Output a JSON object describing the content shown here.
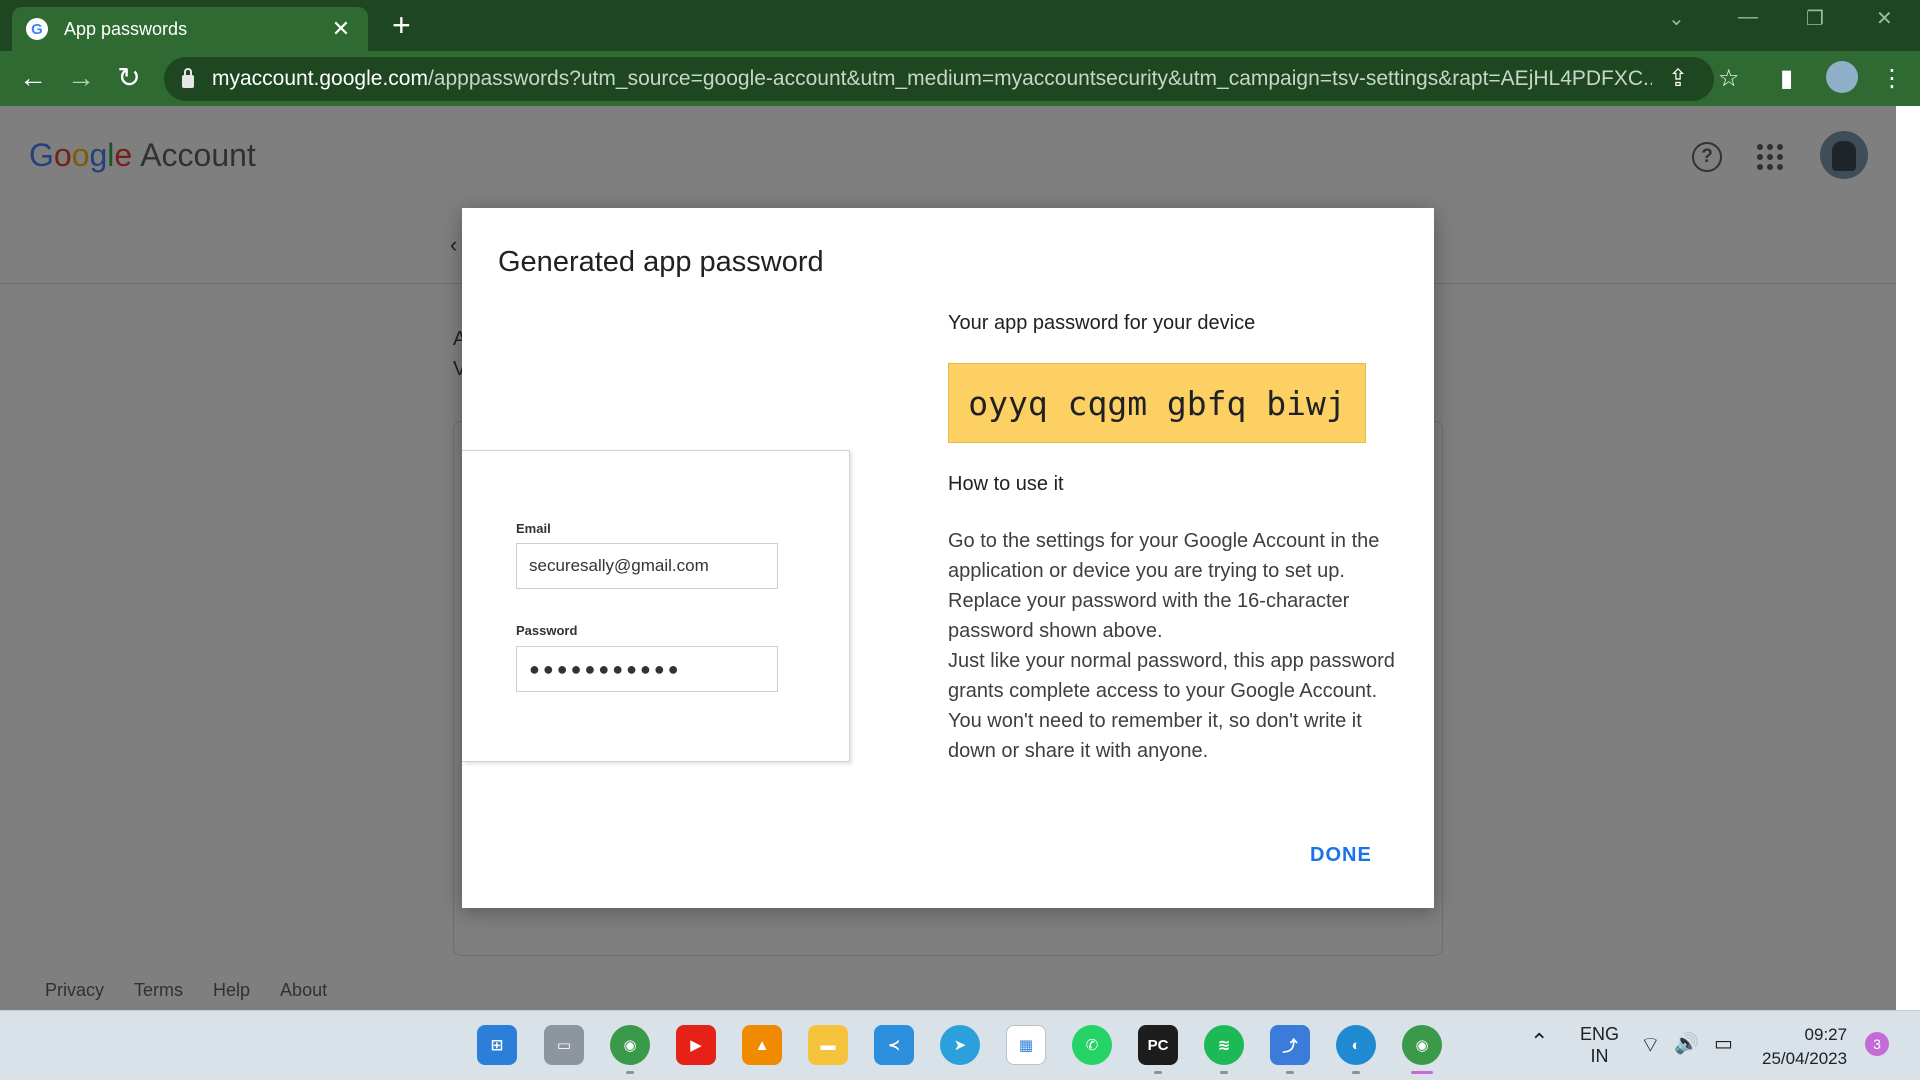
{
  "browser": {
    "tab_title": "App passwords",
    "tab_close": "✕",
    "new_tab": "+",
    "url_host": "myaccount.google.com",
    "url_path": "/apppasswords?utm_source=google-account&utm_medium=myaccountsecurity&utm_campaign=tsv-settings&rapt=AEjHL4PDFXC...",
    "back": "←",
    "forward": "→",
    "reload": "↻",
    "share_icon": "⇪",
    "star_icon": "☆",
    "side_panel_icon": "▮",
    "menu_icon": "⋮",
    "win_chevron": "⌄",
    "win_minimize": "—",
    "win_restore": "❐",
    "win_close": "✕"
  },
  "header": {
    "logo": [
      "G",
      "o",
      "o",
      "g",
      "l",
      "e"
    ],
    "account_label": "Account",
    "help_icon": "?"
  },
  "background": {
    "frag1": "A",
    "frag2": "V",
    "back_arrow": "‹"
  },
  "footer": {
    "links": [
      "Privacy",
      "Terms",
      "Help",
      "About"
    ]
  },
  "dialog": {
    "title": "Generated app password",
    "email_label": "Email",
    "email_value": "securesally@gmail.com",
    "password_label": "Password",
    "password_value": "●●●●●●●●●●●",
    "device_label": "Your app password for your device",
    "app_password": "oyyq cqgm gbfq biwj",
    "how_title": "How to use it",
    "instructions_p1": "Go to the settings for your Google Account in the application or device you are trying to set up. Replace your password with the 16-character password shown above.",
    "instructions_p2": "Just like your normal password, this app password grants complete access to your Google Account. You won't need to remember it, so don't write it down or share it with anyone.",
    "done_label": "DONE"
  },
  "taskbar": {
    "apps": [
      {
        "name": "start-icon",
        "glyph": "⊞",
        "color": "#2b7fd8"
      },
      {
        "name": "file-explorer-icon",
        "glyph": "▭",
        "color": "#8d969e"
      },
      {
        "name": "chrome-icon",
        "glyph": "◉",
        "color": "#3a9a4a"
      },
      {
        "name": "youtube-icon",
        "glyph": "▶",
        "color": "#e62117"
      },
      {
        "name": "vlc-icon",
        "glyph": "▲",
        "color": "#f08a00"
      },
      {
        "name": "folder-icon",
        "glyph": "▬",
        "color": "#f5c33b"
      },
      {
        "name": "vscode-icon",
        "glyph": "≺",
        "color": "#2b8fde"
      },
      {
        "name": "telegram-icon",
        "glyph": "➤",
        "color": "#2aa1da"
      },
      {
        "name": "ms-store-icon",
        "glyph": "▦",
        "color": "#ffffff"
      },
      {
        "name": "whatsapp-icon",
        "glyph": "✆",
        "color": "#25d366"
      },
      {
        "name": "pycharm-icon",
        "glyph": "PC",
        "color": "#1d1d1d"
      },
      {
        "name": "spotify-icon",
        "glyph": "≋",
        "color": "#1db954"
      },
      {
        "name": "dolphin-icon",
        "glyph": "⤴",
        "color": "#3b7bd9"
      },
      {
        "name": "edge-icon",
        "glyph": "◐",
        "color": "#1f8ad1"
      },
      {
        "name": "chrome-profile-icon",
        "glyph": "◉",
        "color": "#3a9a4a"
      }
    ],
    "tray_chevron": "⌃",
    "lang_top": "ENG",
    "lang_bottom": "IN",
    "wifi_icon": "⌔",
    "volume_icon": "🔊",
    "battery_icon": "▭",
    "time": "09:27",
    "date": "25/04/2023",
    "notifications": "3"
  }
}
